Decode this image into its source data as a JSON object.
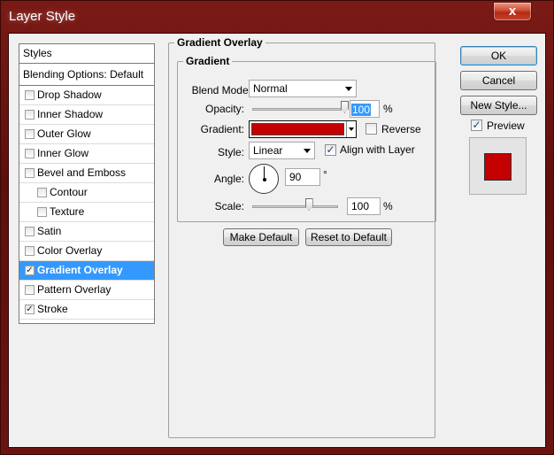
{
  "window": {
    "title": "Layer Style",
    "close_glyph": "x"
  },
  "styles_list": {
    "header": "Styles",
    "blending": "Blending Options: Default",
    "items": [
      {
        "label": "Drop Shadow",
        "checked": false,
        "indent": false,
        "selected": false
      },
      {
        "label": "Inner Shadow",
        "checked": false,
        "indent": false,
        "selected": false
      },
      {
        "label": "Outer Glow",
        "checked": false,
        "indent": false,
        "selected": false
      },
      {
        "label": "Inner Glow",
        "checked": false,
        "indent": false,
        "selected": false
      },
      {
        "label": "Bevel and Emboss",
        "checked": false,
        "indent": false,
        "selected": false
      },
      {
        "label": "Contour",
        "checked": false,
        "indent": true,
        "selected": false
      },
      {
        "label": "Texture",
        "checked": false,
        "indent": true,
        "selected": false
      },
      {
        "label": "Satin",
        "checked": false,
        "indent": false,
        "selected": false
      },
      {
        "label": "Color Overlay",
        "checked": false,
        "indent": false,
        "selected": false
      },
      {
        "label": "Gradient Overlay",
        "checked": true,
        "indent": false,
        "selected": true
      },
      {
        "label": "Pattern Overlay",
        "checked": false,
        "indent": false,
        "selected": false
      },
      {
        "label": "Stroke",
        "checked": true,
        "indent": false,
        "selected": false
      }
    ]
  },
  "panel": {
    "title": "Gradient Overlay",
    "group_title": "Gradient",
    "blend_mode": {
      "label": "Blend Mode:",
      "value": "Normal"
    },
    "opacity": {
      "label": "Opacity:",
      "value": "100",
      "unit": "%",
      "level": 100
    },
    "gradient": {
      "label": "Gradient:",
      "color": "#c40000",
      "reverse_label": "Reverse",
      "reverse": false
    },
    "style": {
      "label": "Style:",
      "value": "Linear",
      "align_label": "Align with Layer",
      "align": true
    },
    "angle": {
      "label": "Angle:",
      "value": "90",
      "unit": "°",
      "degrees": 90
    },
    "scale": {
      "label": "Scale:",
      "value": "100",
      "unit": "%",
      "level": 100
    },
    "make_default": "Make Default",
    "reset_default": "Reset to Default"
  },
  "buttons": {
    "ok": "OK",
    "cancel": "Cancel",
    "new_style": "New Style...",
    "preview_label": "Preview",
    "preview_checked": true,
    "preview_color": "#c40000"
  }
}
